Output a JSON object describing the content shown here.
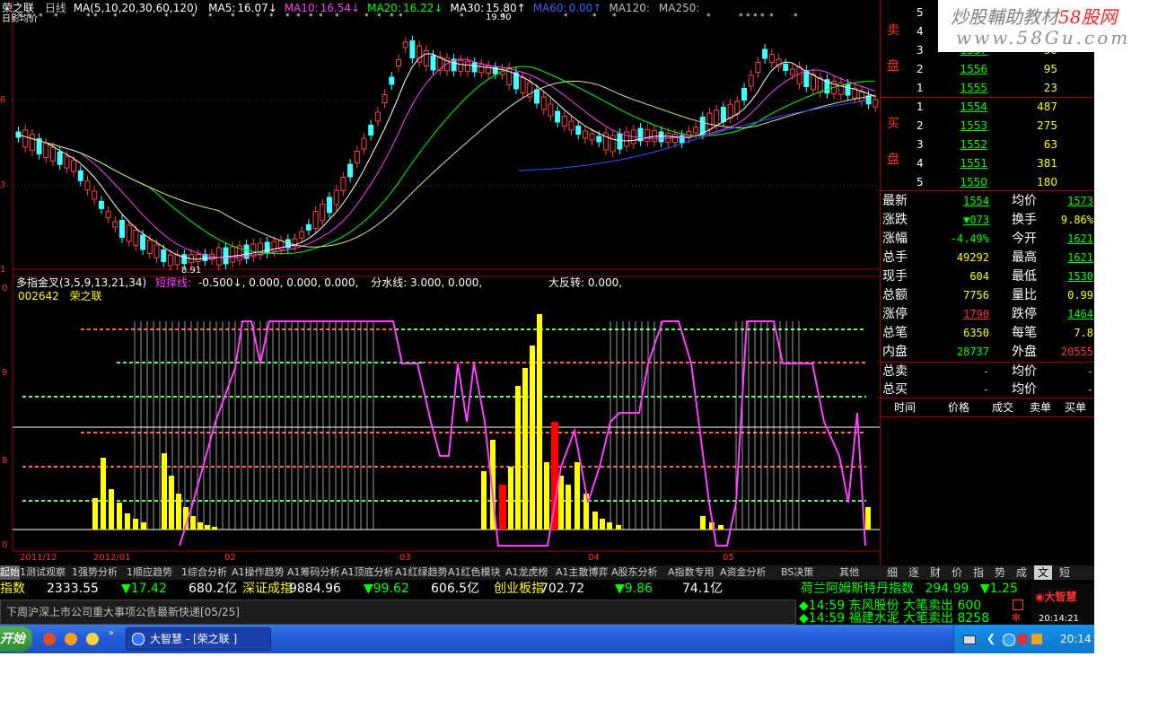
{
  "window": {
    "stock_name": "荣之联",
    "period": "日线",
    "ma_label": "MA(5,10,20,30,60,120)",
    "ma_values": [
      {
        "label": "MA5:",
        "value": "16.07↓",
        "color": "#ffffff"
      },
      {
        "label": "MA10:",
        "value": "16.54↓",
        "color": "#ff40ff"
      },
      {
        "label": "MA20:",
        "value": "16.22↓",
        "color": "#00ff00"
      },
      {
        "label": "MA30:",
        "value": "15.80↑",
        "color": "#ffffff"
      },
      {
        "label": "MA60:",
        "value": "0.00↑",
        "color": "#4060ff"
      },
      {
        "label": "MA120:",
        "value": "",
        "color": "#c0c0c0"
      },
      {
        "label": "MA250:",
        "value": "",
        "color": "#c0c0c0"
      }
    ],
    "sub_label": "日影均价",
    "price_ticks": [
      "6",
      "3",
      "1"
    ],
    "high_marker": "19.90",
    "low_marker": "8.91",
    "indicator_title": "多指金叉(3,5,9,13,21,34)",
    "indicator_short": "短撑线:",
    "indicator_values": "-0.500↓, 0.000, 0.000, 0.000,",
    "indicator_split": "分水线: 3.000, 0.000,",
    "indicator_reverse": "大反转: 0.000,",
    "stock_code": "002642",
    "stock_name2": "荣之联",
    "indicator_ticks": [
      "0",
      "9",
      "8",
      "0"
    ],
    "date_labels": [
      "2011/12",
      "2012/01",
      "02",
      "03",
      "04",
      "05"
    ]
  },
  "order_book": {
    "sell_label": "卖盘",
    "sell_label_chars": [
      "卖",
      "盘"
    ],
    "buy_label_chars": [
      "买",
      "盘"
    ],
    "sell": [
      {
        "level": "5",
        "price": "",
        "vol": ""
      },
      {
        "level": "4",
        "price": "",
        "vol": ""
      },
      {
        "level": "3",
        "price": "1557",
        "vol": "30"
      },
      {
        "level": "2",
        "price": "1556",
        "vol": "95"
      },
      {
        "level": "1",
        "price": "1555",
        "vol": "23"
      }
    ],
    "buy": [
      {
        "level": "1",
        "price": "1554",
        "vol": "487"
      },
      {
        "level": "2",
        "price": "1553",
        "vol": "275"
      },
      {
        "level": "3",
        "price": "1552",
        "vol": "63"
      },
      {
        "level": "4",
        "price": "1551",
        "vol": "381"
      },
      {
        "level": "5",
        "price": "1550",
        "vol": "180"
      }
    ]
  },
  "quote": [
    {
      "l1": "最新",
      "v1": "1554",
      "c1": "#00ff00",
      "u1": true,
      "l2": "均价",
      "v2": "1573",
      "c2": "#00ff00",
      "u2": true
    },
    {
      "l1": "涨跌",
      "v1": "▼073",
      "c1": "#00ff00",
      "u1": true,
      "l2": "换手",
      "v2": "9.86%",
      "c2": "#ffff00",
      "u2": false
    },
    {
      "l1": "涨幅",
      "v1": "-4.49%",
      "c1": "#00ff00",
      "u1": false,
      "l2": "今开",
      "v2": "1621",
      "c2": "#00ff00",
      "u2": true
    },
    {
      "l1": "总手",
      "v1": "49292",
      "c1": "#ffff00",
      "u1": false,
      "l2": "最高",
      "v2": "1621",
      "c2": "#00ff00",
      "u2": true
    },
    {
      "l1": "现手",
      "v1": "604",
      "c1": "#ffff00",
      "u1": false,
      "l2": "最低",
      "v2": "1530",
      "c2": "#00ff00",
      "u2": true
    },
    {
      "l1": "总额",
      "v1": "7756",
      "c1": "#ffff00",
      "u1": false,
      "l2": "量比",
      "v2": "0.99",
      "c2": "#ffff00",
      "u2": false
    },
    {
      "l1": "涨停",
      "v1": "1790",
      "c1": "#ff3030",
      "u1": true,
      "l2": "跌停",
      "v2": "1464",
      "c2": "#00ff00",
      "u2": true
    },
    {
      "l1": "总笔",
      "v1": "6350",
      "c1": "#ffff00",
      "u1": false,
      "l2": "每笔",
      "v2": "7.8",
      "c2": "#ffff00",
      "u2": false
    },
    {
      "l1": "内盘",
      "v1": "28737",
      "c1": "#00ff00",
      "u1": false,
      "l2": "外盘",
      "v2": "20555",
      "c2": "#ff3030",
      "u2": false
    },
    {
      "l1": "总卖",
      "v1": "-",
      "c1": "#c0c0c0",
      "u1": false,
      "l2": "均价",
      "v2": "-",
      "c2": "#c0c0c0",
      "u2": false
    },
    {
      "l1": "总买",
      "v1": "-",
      "c1": "#c0c0c0",
      "u1": false,
      "l2": "均价",
      "v2": "-",
      "c2": "#c0c0c0",
      "u2": false
    }
  ],
  "trade_headers": [
    "时间",
    "价格",
    "成交",
    "卖单",
    "买单"
  ],
  "tabs": [
    "起始",
    "1测试观察",
    "1强势分析",
    "1顺应趋势",
    "1综合分析",
    "A1操作趋势",
    "A1筹码分析",
    "A1顶底分析",
    "A1红绿趋势",
    "A1红色模块",
    "A1龙虎榜",
    "A1主散博弈",
    "A股东分析",
    "A指数专用",
    "A资金分析",
    "BS决策",
    "其他"
  ],
  "right_tabs": [
    "细",
    "逐",
    "财",
    "价",
    "指",
    "势",
    "成",
    "文",
    "短"
  ],
  "ticker": [
    {
      "name": "指数",
      "price": "2333.55",
      "chg": "▼17.42",
      "amt": "680.2亿"
    },
    {
      "name": "深证成指",
      "price": "9884.96",
      "chg": "▼99.62",
      "amt": "606.5亿"
    },
    {
      "name": "创业板指",
      "price": "702.72",
      "chg": "▼9.86",
      "amt": "74.1亿"
    }
  ],
  "ticker_right": {
    "name": "荷兰阿姆斯特丹指数",
    "price": "294.99",
    "chg": "▼1.25"
  },
  "news": "下周沪深上市公司重大事项公告最新快递[05/25]",
  "alerts": [
    {
      "time": "14:59",
      "text": "东风股份 大笔卖出 600"
    },
    {
      "time": "14:59",
      "text": "福建水泥 大笔卖出 8258"
    }
  ],
  "brand": "大智慧",
  "clock": "20:14:21",
  "taskbar": {
    "start": "开始",
    "app": "大智慧 - [荣之联 ]",
    "time": "20:14"
  },
  "watermark": {
    "line1": "炒股輔助教材",
    "site": "58股网",
    "line2": "www.58Gu.com"
  }
}
